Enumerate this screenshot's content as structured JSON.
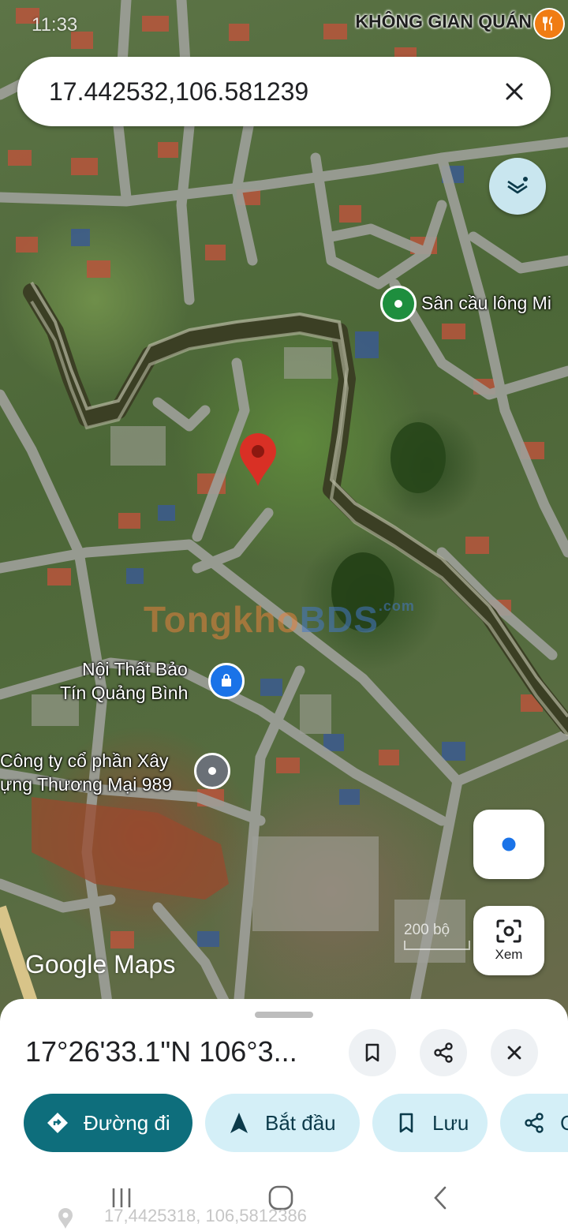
{
  "status_bar": {
    "time": "11:33"
  },
  "map": {
    "top_place_label": "KHÔNG GIAN QUÁN",
    "places": {
      "badminton": "Sân cầu lông Mi",
      "furniture_line1": "Nội Thất Bảo",
      "furniture_line2": "Tín Quảng Bình",
      "company_line1": "Công ty cổ phần Xây",
      "company_line2": "ựng Thương Mại 989"
    },
    "watermark": {
      "part_a": "Tongkho",
      "part_b": "BDS",
      "suffix": ".com"
    },
    "logo": "Google Maps",
    "scale_label": "200 bộ",
    "icons": [
      "restaurant-icon",
      "layers-icon",
      "my-location-icon",
      "lens-icon",
      "close-icon"
    ],
    "colors": {
      "pin": "#d93025",
      "location": "#1a73e8",
      "accent": "#0e6e7c"
    }
  },
  "search": {
    "value": "17.442532,106.581239"
  },
  "xem_button": {
    "label": "Xem"
  },
  "sheet": {
    "title": "17°26'33.1\"N 106°3...",
    "actions": {
      "directions": "Đường đi",
      "start": "Bắt đầu",
      "save": "Lưu",
      "share": "C"
    }
  },
  "bottom_coords": "17,4425318, 106,5812386"
}
